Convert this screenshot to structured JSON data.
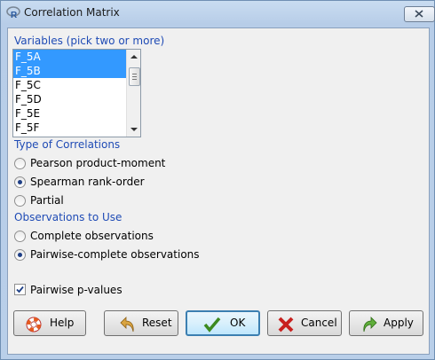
{
  "window": {
    "title": "Correlation Matrix"
  },
  "variables": {
    "label": "Variables (pick two or more)",
    "items": [
      {
        "label": "F_5A",
        "selected": true
      },
      {
        "label": "F_5B",
        "selected": true
      },
      {
        "label": "F_5C",
        "selected": false
      },
      {
        "label": "F_5D",
        "selected": false
      },
      {
        "label": "F_5E",
        "selected": false
      },
      {
        "label": "F_5F",
        "selected": false
      }
    ]
  },
  "correlation_type": {
    "label": "Type of Correlations",
    "options": [
      "Pearson product-moment",
      "Spearman rank-order",
      "Partial"
    ],
    "selected": "Spearman rank-order"
  },
  "observations": {
    "label": "Observations to Use",
    "options": [
      "Complete observations",
      "Pairwise-complete observations"
    ],
    "selected": "Pairwise-complete observations"
  },
  "pairwise_pvalues": {
    "label": "Pairwise p-values",
    "checked": true
  },
  "buttons": {
    "help": "Help",
    "reset": "Reset",
    "ok": "OK",
    "cancel": "Cancel",
    "apply": "Apply"
  },
  "colors": {
    "section_label": "#1f4bb5",
    "selection": "#3399ff"
  }
}
